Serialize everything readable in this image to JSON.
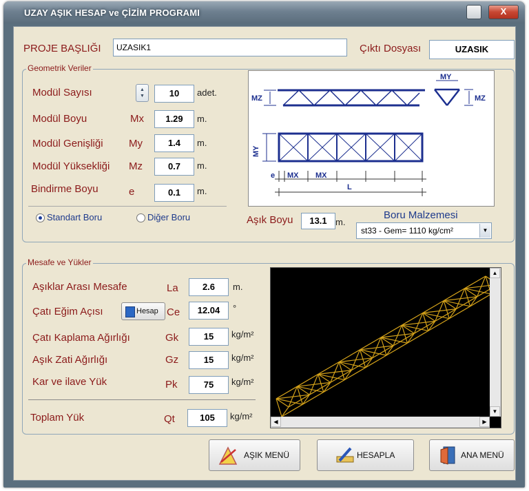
{
  "window": {
    "title": "UZAY AŞIK  HESAP  ve  ÇİZİM PROGRAMI",
    "close_label": "X"
  },
  "header": {
    "project_title_label": "PROJE BAŞLIĞI",
    "project_title_value": "UZASIK1",
    "output_file_label": "Çıktı Dosyası",
    "output_file_value": "UZASIK"
  },
  "geometry": {
    "group_label": "Geometrik Veriler",
    "module_count_label": "Modül Sayısı",
    "module_count_value": "10",
    "module_count_unit": "adet.",
    "module_length_label": "Modül Boyu",
    "module_length_symbol": "Mx",
    "module_length_value": "1.29",
    "module_length_unit": "m.",
    "module_width_label": "Modül Genişliği",
    "module_width_symbol": "My",
    "module_width_value": "1.4",
    "module_width_unit": "m.",
    "module_height_label": "Modül Yüksekliği",
    "module_height_symbol": "Mz",
    "module_height_value": "0.7",
    "module_height_unit": "m.",
    "overlap_label": "Bindirme Boyu",
    "overlap_symbol": "e",
    "overlap_value": "0.1",
    "overlap_unit": "m.",
    "radio_standard": "Standart Boru",
    "radio_other": "Diğer Boru",
    "radio_selected": "standard",
    "purlin_length_label": "Aşık Boyu",
    "purlin_length_value": "13.1",
    "purlin_length_unit": "m.",
    "material_label": "Boru Malzemesi",
    "material_value": "st33 - Gem= 1110 kg/cm²",
    "diagram_labels": {
      "mz": "MZ",
      "my": "MY",
      "mx": "MX",
      "e": "e",
      "l": "L"
    }
  },
  "loads": {
    "group_label": "Mesafe ve Yükler",
    "spacing_label": "Aşıklar Arası Mesafe",
    "spacing_symbol": "La",
    "spacing_value": "2.6",
    "spacing_unit": "m.",
    "roof_angle_label": "Çatı Eğim Açısı",
    "roof_angle_button": "Hesap",
    "roof_angle_symbol": "Ce",
    "roof_angle_value": "12.04",
    "roof_angle_unit": "°",
    "roof_cover_label": "Çatı Kaplama Ağırlığı",
    "roof_cover_symbol": "Gk",
    "roof_cover_value": "15",
    "roof_cover_unit": "kg/m²",
    "self_weight_label": "Aşık Zati Ağırlığı",
    "self_weight_symbol": "Gz",
    "self_weight_value": "15",
    "self_weight_unit": "kg/m²",
    "snow_label": "Kar ve  ilave Yük",
    "snow_symbol": "Pk",
    "snow_value": "75",
    "snow_unit": "kg/m²",
    "total_label": "Toplam Yük",
    "total_symbol": "Qt",
    "total_value": "105",
    "total_unit": "kg/m²"
  },
  "buttons": {
    "purlin_menu": "AŞIK MENÜ",
    "calculate": "HESAPLA",
    "main_menu": "ANA MENÜ"
  },
  "colors": {
    "label_text": "#8b1a1a",
    "radio_text": "#1e3a8c",
    "diagram_blue": "#1c2f8f",
    "truss_yellow": "#d4a21a",
    "canvas_bg": "#000000",
    "client_bg": "#ece6d2"
  }
}
